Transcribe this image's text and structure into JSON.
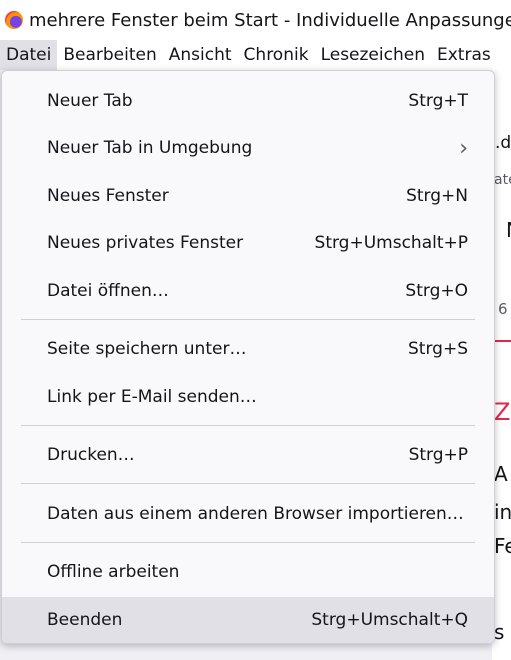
{
  "window": {
    "title": "mehrere Fenster beim Start - Individuelle Anpassungen -"
  },
  "menubar": {
    "items": [
      {
        "label": "Datei"
      },
      {
        "label": "Bearbeiten"
      },
      {
        "label": "Ansicht"
      },
      {
        "label": "Chronik"
      },
      {
        "label": "Lesezeichen"
      },
      {
        "label": "Extras"
      }
    ]
  },
  "file_menu": {
    "items": [
      {
        "label": "Neuer Tab",
        "shortcut": "Strg+T"
      },
      {
        "label": "Neuer Tab in Umgebung",
        "shortcut": "",
        "submenu_icon": "chevron-right-icon",
        "chevron": "›"
      },
      {
        "label": "Neues Fenster",
        "shortcut": "Strg+N"
      },
      {
        "label": "Neues privates Fenster",
        "shortcut": "Strg+Umschalt+P"
      },
      {
        "label": "Datei öffnen…",
        "shortcut": "Strg+O"
      },
      {
        "label": "Seite speichern unter…",
        "shortcut": "Strg+S"
      },
      {
        "label": "Link per E-Mail senden…",
        "shortcut": ""
      },
      {
        "label": "Drucken…",
        "shortcut": "Strg+P"
      },
      {
        "label": "Daten aus einem anderen Browser importieren…",
        "shortcut": ""
      },
      {
        "label": "Offline arbeiten",
        "shortcut": ""
      },
      {
        "label": "Beenden",
        "shortcut": "Strg+Umschalt+Q"
      }
    ]
  },
  "background_fragments": {
    "url_fragment": ".d",
    "tab_fragment": "ate",
    "heading_fragment": "N",
    "count_fragment": "6",
    "link_fragment": "Z",
    "text_1": "A",
    "text_2": "in",
    "text_3": "Fe",
    "text_4": "s"
  },
  "colors": {
    "accent": "#e22850",
    "menu_background": "#f9f9fb",
    "hover_background": "#e0e0e6",
    "separator": "#cfcfd8"
  }
}
